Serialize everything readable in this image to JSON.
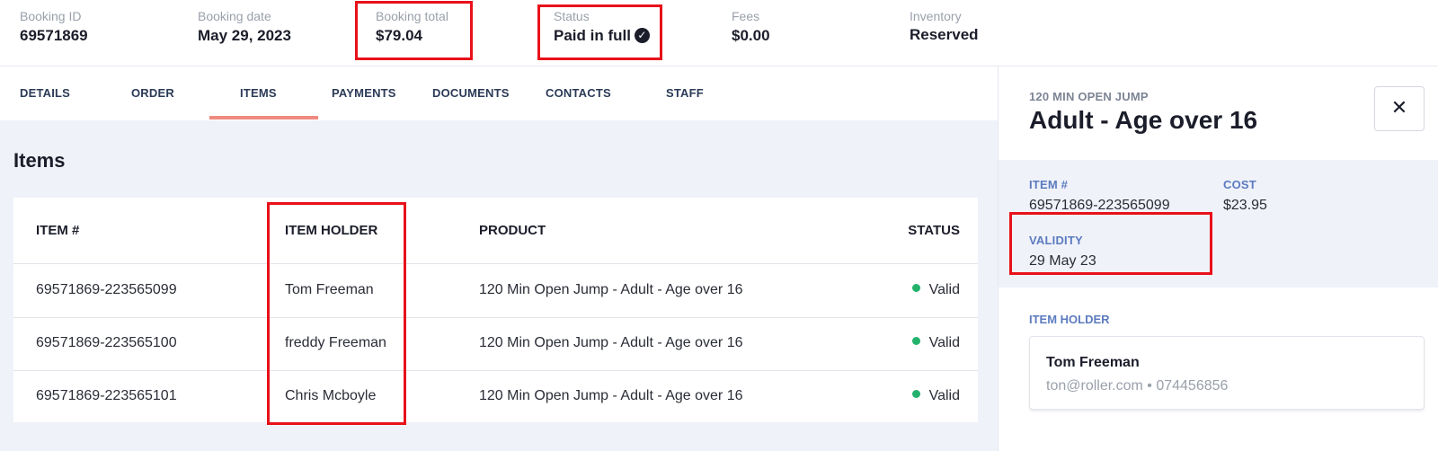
{
  "summary": {
    "booking_id": {
      "label": "Booking ID",
      "value": "69571869"
    },
    "booking_date": {
      "label": "Booking date",
      "value": "May 29, 2023"
    },
    "booking_total": {
      "label": "Booking total",
      "value": "$79.04"
    },
    "status": {
      "label": "Status",
      "value": "Paid in full",
      "icon": "check-circle-icon"
    },
    "fees": {
      "label": "Fees",
      "value": "$0.00"
    },
    "inventory": {
      "label": "Inventory",
      "value": "Reserved"
    }
  },
  "tabs": [
    {
      "label": "DETAILS",
      "active": false
    },
    {
      "label": "ORDER",
      "active": false
    },
    {
      "label": "ITEMS",
      "active": true
    },
    {
      "label": "PAYMENTS",
      "active": false
    },
    {
      "label": "DOCUMENTS",
      "active": false
    },
    {
      "label": "CONTACTS",
      "active": false
    },
    {
      "label": "STAFF",
      "active": false
    }
  ],
  "items_section": {
    "title": "Items",
    "columns": [
      "ITEM #",
      "ITEM HOLDER",
      "PRODUCT",
      "STATUS"
    ],
    "rows": [
      {
        "item": "69571869-223565099",
        "holder": "Tom Freeman",
        "product": "120 Min Open Jump - Adult - Age over 16",
        "status": "Valid"
      },
      {
        "item": "69571869-223565100",
        "holder": "freddy Freeman",
        "product": "120 Min Open Jump - Adult - Age over 16",
        "status": "Valid"
      },
      {
        "item": "69571869-223565101",
        "holder": "Chris Mcboyle",
        "product": "120 Min Open Jump - Adult - Age over 16",
        "status": "Valid"
      }
    ]
  },
  "panel": {
    "subtitle": "120 MIN OPEN JUMP",
    "title": "Adult - Age over 16",
    "close_icon": "close-icon",
    "item_label": "ITEM #",
    "item_value": "69571869-223565099",
    "cost_label": "COST",
    "cost_value": "$23.95",
    "validity_label": "VALIDITY",
    "validity_value": "29 May 23",
    "holder_label": "ITEM HOLDER",
    "holder_name": "Tom Freeman",
    "holder_contact": "ton@roller.com • 074456856"
  },
  "colors": {
    "highlight_box": "#e8111a",
    "tab_underline": "#f08a80",
    "valid_dot": "#23b26d",
    "panel_label": "#5b7bbf"
  }
}
